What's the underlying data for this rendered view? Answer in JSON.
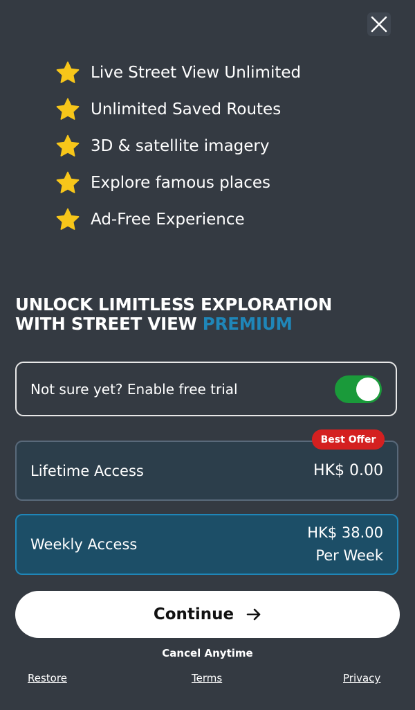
{
  "close": {
    "icon": "close-icon"
  },
  "features": [
    {
      "icon": "star-icon",
      "label": "Live Street View Unlimited"
    },
    {
      "icon": "star-icon",
      "label": "Unlimited Saved Routes"
    },
    {
      "icon": "star-icon",
      "label": "3D & satellite imagery"
    },
    {
      "icon": "star-icon",
      "label": "Explore famous places"
    },
    {
      "icon": "star-icon",
      "label": "Ad-Free Experience"
    }
  ],
  "headline": {
    "line1": "UNLOCK LIMITLESS EXPLORATION",
    "line2_prefix": "WITH STREET VIEW ",
    "line2_highlight": "PREMIUM"
  },
  "trial": {
    "label": "Not sure yet? Enable free trial",
    "enabled": true
  },
  "plans": [
    {
      "name": "Lifetime Access",
      "price": "HK$ 0.00",
      "badge": "Best Offer",
      "selected": false
    },
    {
      "name": "Weekly Access",
      "price": "HK$ 38.00",
      "period": "Per Week",
      "selected": true
    }
  ],
  "continue": {
    "label": "Continue",
    "icon": "arrow-right-icon"
  },
  "cancel_text": "Cancel Anytime",
  "footer": {
    "restore": "Restore",
    "terms": "Terms",
    "privacy": "Privacy"
  },
  "colors": {
    "background": "#343a42",
    "accent": "#1f86b8",
    "toggle_on": "#1a9a3a",
    "badge": "#d42020",
    "star": "#f7c61a"
  }
}
